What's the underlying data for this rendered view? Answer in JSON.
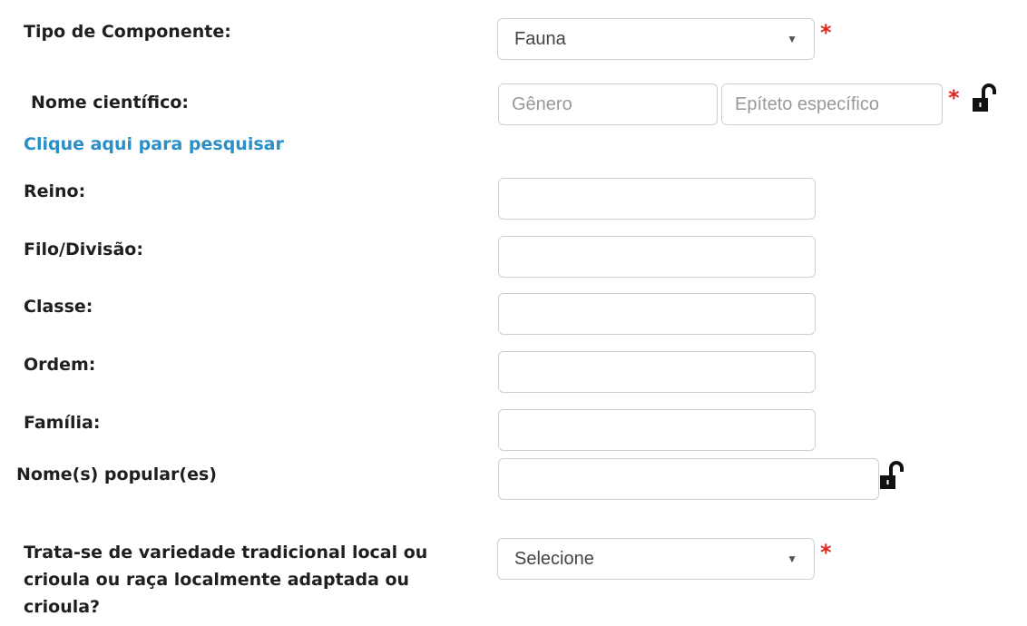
{
  "tipo": {
    "label": "Tipo de Componente:",
    "value": "Fauna"
  },
  "nome_cientifico": {
    "label": "Nome científico:",
    "genero_placeholder": "Gênero",
    "epiteto_placeholder": "Epíteto específico"
  },
  "search_link": "Clique aqui para pesquisar",
  "reino": {
    "label": "Reino:",
    "value": ""
  },
  "filo": {
    "label": "Filo/Divisão:",
    "value": ""
  },
  "classe": {
    "label": "Classe:",
    "value": ""
  },
  "ordem": {
    "label": "Ordem:",
    "value": ""
  },
  "familia": {
    "label": "Família:",
    "value": ""
  },
  "nome_popular": {
    "label": "Nome(s) popular(es)",
    "value": ""
  },
  "variedade": {
    "label": "Trata-se de variedade tradicional local ou crioula ou raça localmente adaptada ou crioula?",
    "value": "Selecione"
  },
  "required_mark": "*",
  "icons": {
    "lock": "lock-open-icon",
    "caret": "caret-down-icon"
  },
  "colors": {
    "link": "#2a8fc7",
    "required": "#e0271e",
    "border": "#cfcfcf"
  }
}
